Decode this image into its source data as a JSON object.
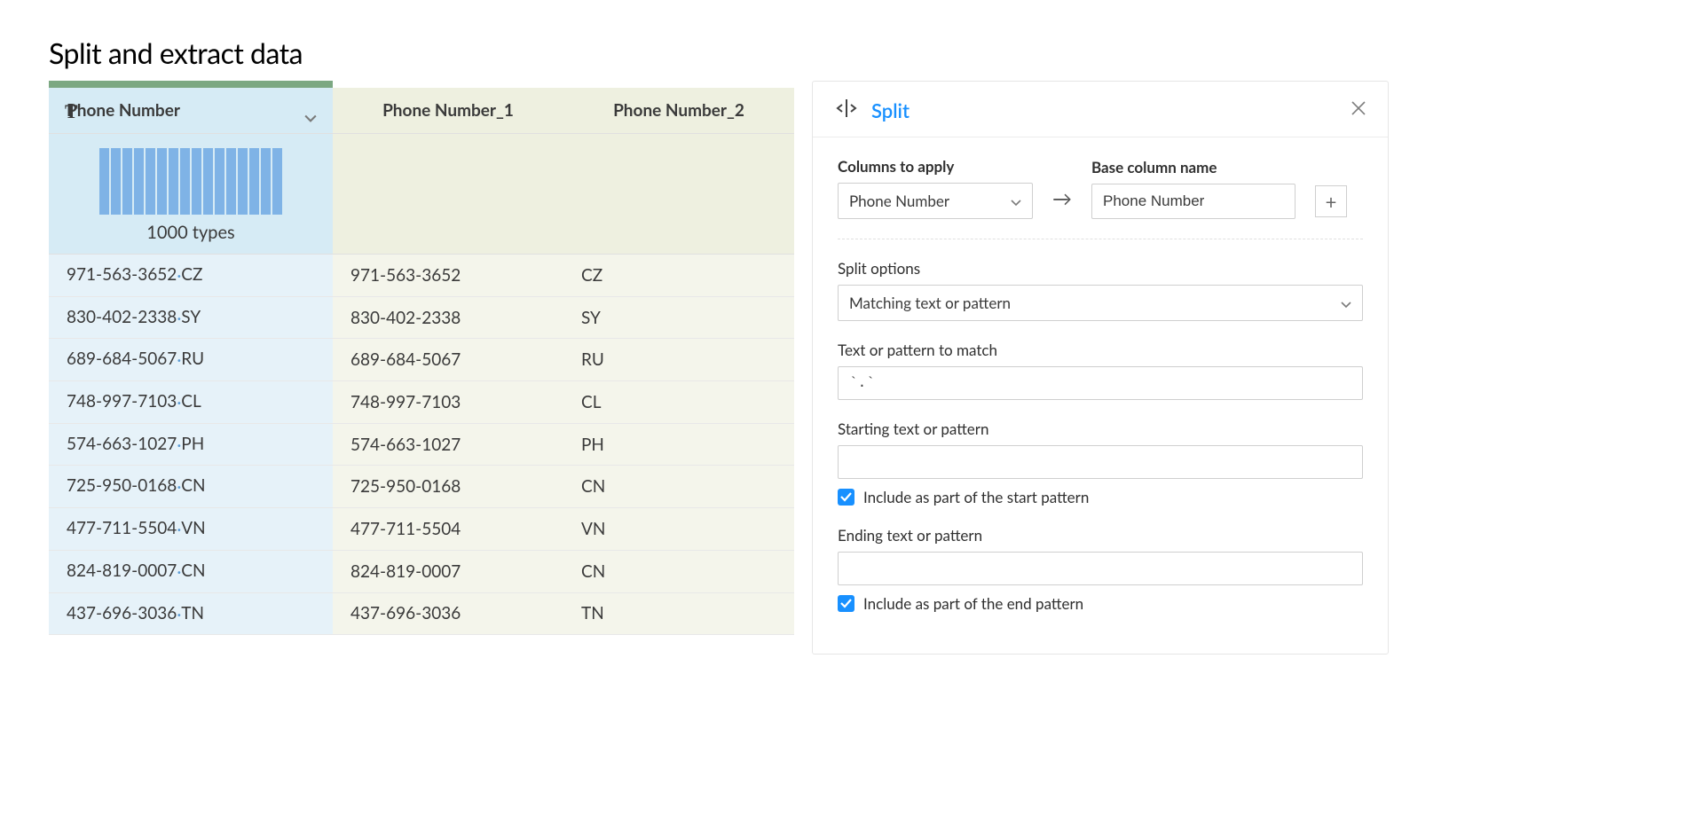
{
  "title": "Split and extract data",
  "table": {
    "columns": [
      "Phone Number",
      "Phone Number_1",
      "Phone Number_2"
    ],
    "types_label": "1000 types",
    "rows": [
      {
        "raw_a": "971-563-3652",
        "raw_b": "CZ",
        "c1": "971-563-3652",
        "c2": "CZ"
      },
      {
        "raw_a": "830-402-2338",
        "raw_b": "SY",
        "c1": "830-402-2338",
        "c2": "SY"
      },
      {
        "raw_a": "689-684-5067",
        "raw_b": "RU",
        "c1": "689-684-5067",
        "c2": "RU"
      },
      {
        "raw_a": "748-997-7103",
        "raw_b": "CL",
        "c1": "748-997-7103",
        "c2": "CL"
      },
      {
        "raw_a": "574-663-1027",
        "raw_b": "PH",
        "c1": "574-663-1027",
        "c2": "PH"
      },
      {
        "raw_a": "725-950-0168",
        "raw_b": "CN",
        "c1": "725-950-0168",
        "c2": "CN"
      },
      {
        "raw_a": "477-711-5504",
        "raw_b": "VN",
        "c1": "477-711-5504",
        "c2": "VN"
      },
      {
        "raw_a": "824-819-0007",
        "raw_b": "CN",
        "c1": "824-819-0007",
        "c2": "CN"
      },
      {
        "raw_a": "437-696-3036",
        "raw_b": "TN",
        "c1": "437-696-3036",
        "c2": "TN"
      }
    ]
  },
  "panel": {
    "title": "Split",
    "columns_to_apply_label": "Columns to apply",
    "columns_to_apply_value": "Phone Number",
    "base_column_label": "Base column name",
    "base_column_value": "Phone Number",
    "split_options_label": "Split options",
    "split_options_value": "Matching text or pattern",
    "pattern_label": "Text or pattern to match",
    "pattern_value": "`.`",
    "starting_label": "Starting text or pattern",
    "starting_value": "",
    "include_start_label": "Include as part of the start pattern",
    "ending_label": "Ending text or pattern",
    "ending_value": "",
    "include_end_label": "Include as part of the end pattern"
  }
}
